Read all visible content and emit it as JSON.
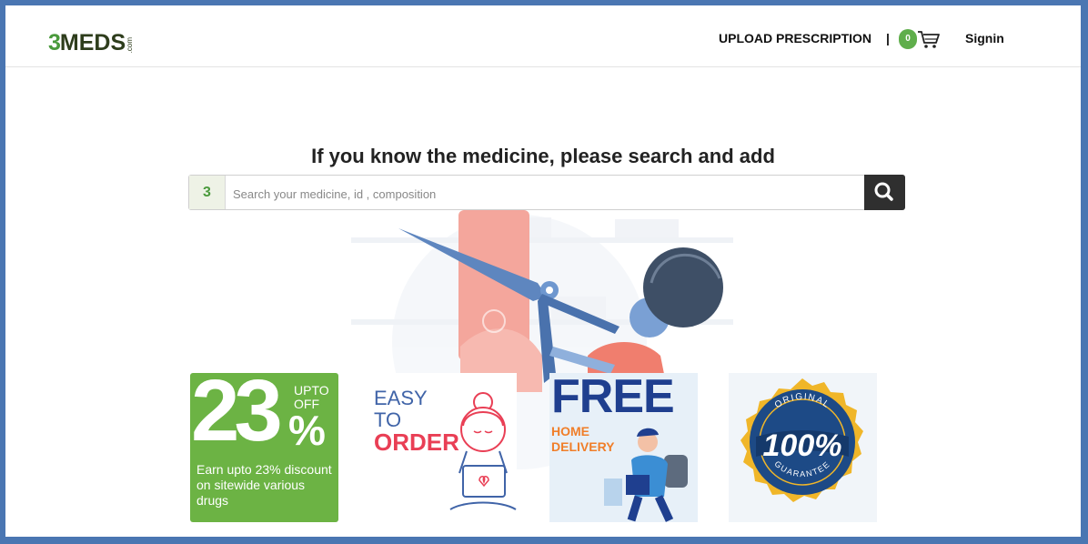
{
  "logo": {
    "digit": "3",
    "name": "MEDS",
    "suffix": ".com"
  },
  "header": {
    "upload_label": "UPLOAD PRESCRIPTION",
    "separator": "|",
    "cart_count": "0",
    "signin_label": "Signin"
  },
  "main": {
    "headline": "If you know the medicine, please search and add",
    "search": {
      "badge": "3",
      "placeholder": "Search your medicine, id , composition"
    }
  },
  "tiles": {
    "discount": {
      "number": "23",
      "upto": "UPTO",
      "off": "OFF",
      "percent": "%",
      "desc": "Earn upto 23% discount on sitewide various drugs"
    },
    "easy": {
      "line1": "EASY",
      "line2": "TO",
      "line3": "ORDER"
    },
    "free": {
      "title": "FREE",
      "line1": "HOME",
      "line2": "DELIVERY"
    },
    "guarantee": {
      "top": "ORIGINAL",
      "center": "100%",
      "bottom": "GUARANTEE"
    }
  },
  "colors": {
    "brand_green": "#4a9a3c",
    "frame_blue": "#4a76b2",
    "dark": "#2f2f2f"
  }
}
